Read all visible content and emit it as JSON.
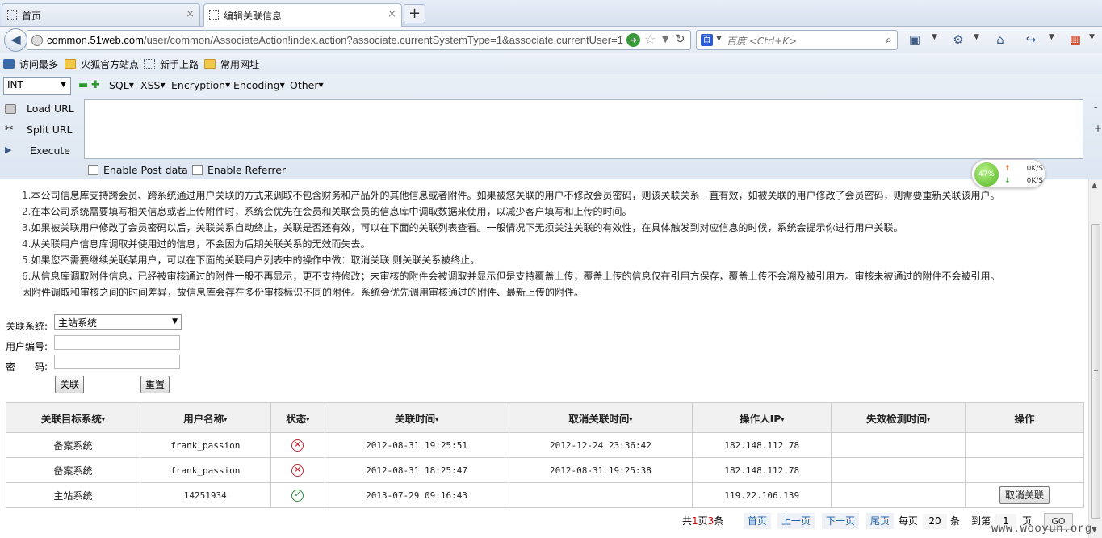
{
  "browser": {
    "tabs": [
      {
        "label": "首页",
        "close": "×"
      },
      {
        "label": "编辑关联信息",
        "close": "×"
      }
    ],
    "new_tab": "+",
    "url_host": "common.51web.com",
    "url_path": "/user/common/AssociateAction!index.action?associate.currentSystemType=1&associate.currentUser=1",
    "search_placeholder": "百度 <Ctrl+K>",
    "bookmarks": [
      "访问最多",
      "火狐官方站点",
      "新手上路",
      "常用网址"
    ]
  },
  "hackbar": {
    "select_value": "INT",
    "menus": [
      "SQL",
      "XSS",
      "Encryption",
      "Encoding",
      "Other"
    ],
    "buttons": [
      "Load URL",
      "Split URL",
      "Execute"
    ],
    "checkboxes": [
      "Enable Post data",
      "Enable Referrer"
    ]
  },
  "speed_widget": {
    "percent": "47%",
    "up": "0K/S",
    "down": "0K/S"
  },
  "notes": [
    {
      "num": "1.",
      "text": "本公司信息库支持跨会员、跨系统通过用户关联的方式来调取不包含财务和产品外的其他信息或者附件。如果被您关联的用户不修改会员密码，则该关联关系一直有效，如被关联的用户修改了会员密码，则需要重新关联该用户。"
    },
    {
      "num": "2.",
      "text": "在本公司系统需要填写相关信息或者上传附件时，系统会优先在会员和关联会员的信息库中调取数据来使用，以减少客户填写和上传的时间。"
    },
    {
      "num": "3.",
      "text": "如果被关联用户修改了会员密码以后，关联关系自动终止，关联是否还有效，可以在下面的关联列表查看。一般情况下无须关注关联的有效性，在具体触发到对应信息的时候，系统会提示你进行用户关联。"
    },
    {
      "num": "4.",
      "text": "从关联用户信息库调取并使用过的信息，不会因为后期关联关系的无效而失去。"
    },
    {
      "num": "5.",
      "text": "如果您不需要继续关联某用户，可以在下面的关联用户列表中的操作中做：取消关联 则关联关系被终止。"
    },
    {
      "num": "6.",
      "text": "从信息库调取附件信息，已经被审核通过的附件一般不再显示，更不支持修改；未审核的附件会被调取并显示但是支持覆盖上传，覆盖上传的信息仅在引用方保存，覆盖上传不会溯及被引用方。审核未被通过的附件不会被引用。"
    },
    {
      "num": "",
      "text": "因附件调取和审核之间的时间差异，故信息库会存在多份审核标识不同的附件。系统会优先调用审核通过的附件、最新上传的附件。"
    }
  ],
  "form": {
    "system_label": "关联系统:",
    "system_value": "主站系统",
    "user_label": "用户编号:",
    "password_label": "密　　码:",
    "submit_label": "关联",
    "reset_label": "重置"
  },
  "table": {
    "sort_glyph": "▾",
    "headers": [
      {
        "label": "关联目标系统",
        "sortable": true
      },
      {
        "label": "用户名称",
        "sortable": true
      },
      {
        "label": "状态",
        "sortable": true
      },
      {
        "label": "关联时间",
        "sortable": true
      },
      {
        "label": "取消关联时间",
        "sortable": true
      },
      {
        "label": "操作人IP",
        "sortable": true
      },
      {
        "label": "失效检测时间",
        "sortable": true
      },
      {
        "label": "操作",
        "sortable": false
      }
    ],
    "rows": [
      {
        "system": "备案系统",
        "user": "frank_passion",
        "status": "invalid",
        "status_glyph": "×",
        "assoc_time": "2012-08-31 19:25:51",
        "cancel_time": "2012-12-24 23:36:42",
        "ip": "182.148.112.78",
        "check_time": "",
        "action": ""
      },
      {
        "system": "备案系统",
        "user": "frank_passion",
        "status": "invalid",
        "status_glyph": "×",
        "assoc_time": "2012-08-31 18:25:47",
        "cancel_time": "2012-08-31 19:25:38",
        "ip": "182.148.112.78",
        "check_time": "",
        "action": ""
      },
      {
        "system": "主站系统",
        "user": "14251934",
        "status": "valid",
        "status_glyph": "✓",
        "assoc_time": "2013-07-29 09:16:43",
        "cancel_time": "",
        "ip": "119.22.106.139",
        "check_time": "",
        "action": "取消关联"
      }
    ]
  },
  "pager": {
    "total_prefix": "共",
    "total_pages": "1",
    "page_word": "页",
    "total_items": "3",
    "items_word": "条",
    "first": "首页",
    "prev": "上一页",
    "next": "下一页",
    "last": "尾页",
    "per_page_prefix": "每页",
    "per_page": "20",
    "per_page_suffix": "条",
    "goto_prefix": "到第",
    "goto_page": "1",
    "goto_suffix": "页",
    "go": "GO"
  },
  "watermark": "www.wooyun.org",
  "colors": {
    "invalid": "#c0282d",
    "valid": "#2e8b3a",
    "link": "#1f5fae"
  }
}
